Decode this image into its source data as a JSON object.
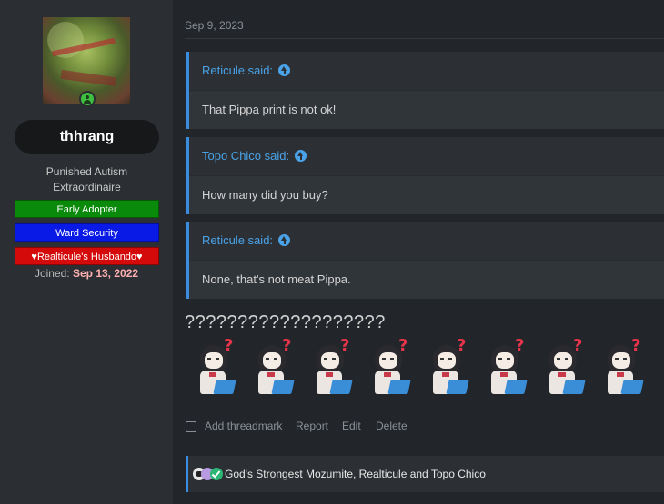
{
  "user": {
    "name": "thhrang",
    "title": "Punished Autism Extraordinaire",
    "banners": [
      "Early Adopter",
      "Ward Security",
      "♥Realticule's Husbando♥"
    ],
    "joined_label": "Joined:",
    "joined_date": "Sep 13, 2022"
  },
  "post": {
    "date": "Sep 9, 2023",
    "quotes": [
      {
        "author": "Reticule said:",
        "text": "That Pippa print is not ok!"
      },
      {
        "author": "Topo Chico said:",
        "text": "How many did you buy?"
      },
      {
        "author": "Reticule said:",
        "text": "None, that's not meat Pippa."
      }
    ],
    "message": "???????????????????",
    "emote_glyph": "?",
    "emote_count": 8
  },
  "actions": {
    "threadmark": "Add threadmark",
    "report": "Report",
    "edit": "Edit",
    "delete": "Delete"
  },
  "reactions": {
    "icons": [
      "skull-icon",
      "purple-avatar-icon",
      "checkmark-icon"
    ],
    "text": "God's Strongest Mozumite, Realticule and Topo Chico"
  },
  "colors": {
    "accent": "#3a8dde",
    "banner_green": "#0a8a0a",
    "banner_blue": "#0a1ae6",
    "banner_red": "#d40a0a",
    "joined_date": "#ffb0b0"
  }
}
